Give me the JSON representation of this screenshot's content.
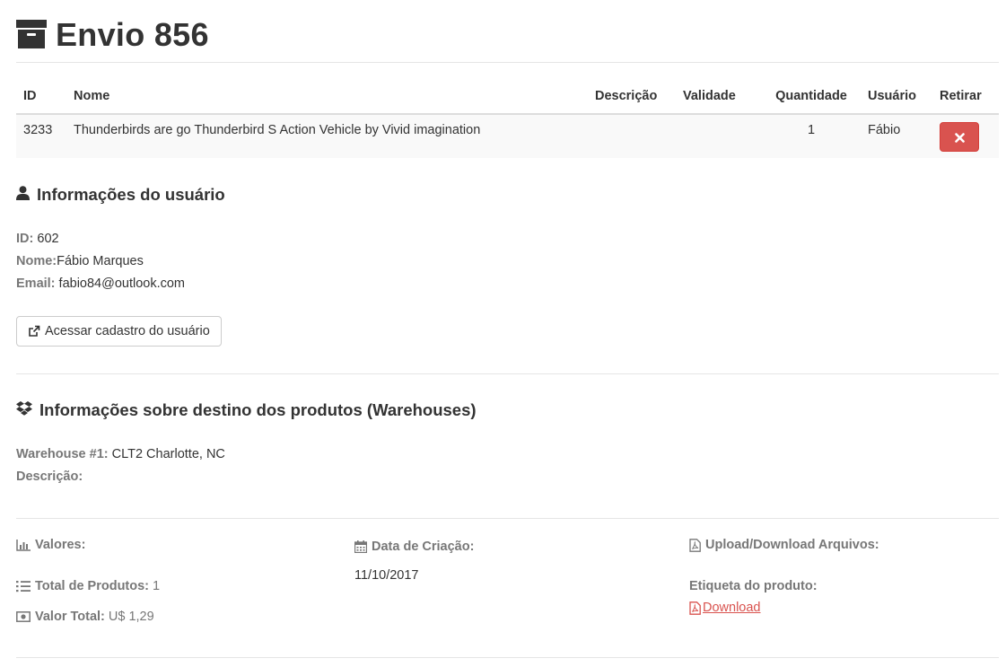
{
  "header": {
    "title": "Envio 856",
    "icon": "archive-icon"
  },
  "items_table": {
    "columns": [
      "ID",
      "Nome",
      "Descrição",
      "Validade",
      "Quantidade",
      "Usuário",
      "Retirar"
    ],
    "rows": [
      {
        "id": "3233",
        "nome": "Thunderbirds are go Thunderbird S Action Vehicle by Vivid imagination",
        "descricao": "",
        "validade": "",
        "quantidade": "1",
        "usuario": "Fábio",
        "remove_icon": "times-icon"
      }
    ]
  },
  "user_info": {
    "title": "Informações do usuário",
    "icon": "user-icon",
    "id_label": "ID:",
    "id_value": "602",
    "name_label": "Nome:",
    "name_value": "Fábio Marques",
    "email_label": "Email:",
    "email_value": "fabio84@outlook.com",
    "access_button": "Acessar cadastro do usuário"
  },
  "warehouse_info": {
    "title": "Informações sobre destino dos produtos (Warehouses)",
    "icon": "dropbox-icon",
    "warehouse_label": "Warehouse #1:",
    "warehouse_value": "CLT2 Charlotte, NC",
    "description_label": "Descrição:",
    "description_value": ""
  },
  "summary": {
    "valores_label": "Valores:",
    "total_produtos_label": "Total de Produtos:",
    "total_produtos_value": "1",
    "valor_total_label": "Valor Total:",
    "valor_total_value": "U$ 1,29",
    "data_criacao_label": "Data de Criação:",
    "data_criacao_value": "11/10/2017",
    "upload_label": "Upload/Download Arquivos:",
    "etiqueta_label": "Etiqueta do produto:",
    "download_link": "Download"
  },
  "colors": {
    "danger": "#d9534f",
    "muted_label": "#777777",
    "text": "#333333"
  }
}
